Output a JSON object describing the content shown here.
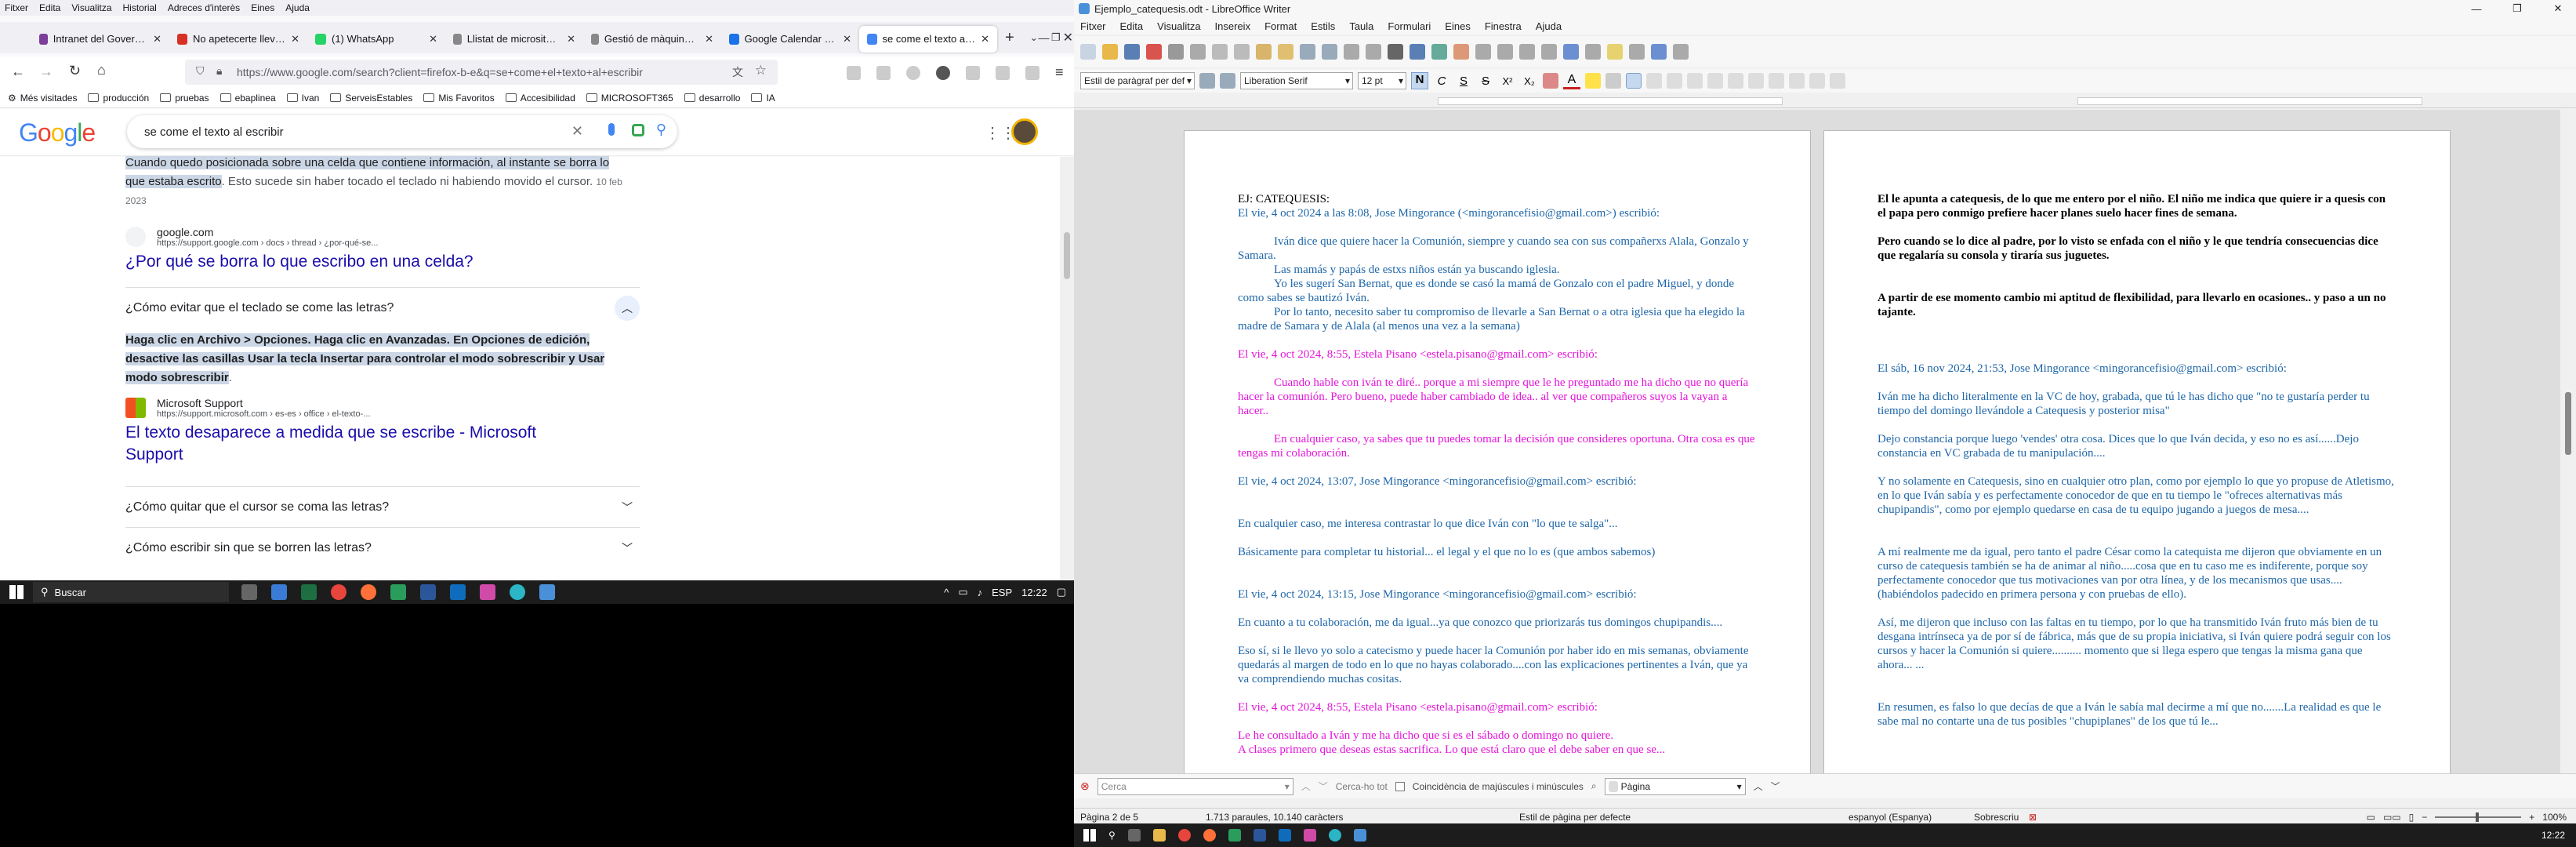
{
  "firefox": {
    "menu": [
      "Fitxer",
      "Edita",
      "Visualitza",
      "Historial",
      "Adreces d'interès",
      "Eines",
      "Ajuda"
    ],
    "tabs": [
      {
        "label": "Intranet del Govern de les I",
        "color": "#7b3f99"
      },
      {
        "label": "No apetecerte llevar a",
        "color": "#d93025"
      },
      {
        "label": "(1) WhatsApp",
        "color": "#25d366"
      },
      {
        "label": "Llistat de microsites - Gesti",
        "color": "#888888"
      },
      {
        "label": "Gestió de màquines - SERVE",
        "color": "#888888"
      },
      {
        "label": "Google Calendar - nov",
        "color": "#1a73e8"
      },
      {
        "label": "se come el texto al esc",
        "color": "#4285f4"
      }
    ],
    "url": "https://www.google.com/search?client=firefox-b-e&q=se+come+el+texto+al+escribir",
    "bookmarks": [
      "Més visitades",
      "producción",
      "pruebas",
      "ebaplinea",
      "Ivan",
      "ServeisEstables",
      "Mis Favoritos",
      "Accesibilidad",
      "MICROSOFT365",
      "desarrollo",
      "IA"
    ],
    "google": {
      "logo": [
        "G",
        "o",
        "o",
        "g",
        "l",
        "e"
      ],
      "query": "se come el texto al escribir",
      "snippet1_hl": "Cuando quedo posicionada sobre una celda que contiene información, al instante se borra lo que estaba escrito",
      "snippet1_rest": ". Esto sucede sin haber tocado el teclado ni habiendo movido el cursor.",
      "snippet1_date": "10 feb 2023",
      "result1_site": "google.com",
      "result1_url": "https://support.google.com › docs › thread › ¿por-qué-se...",
      "result1_title": "¿Por qué se borra lo que escribo en una celda?",
      "faq1": "¿Cómo evitar que el teclado se come las letras?",
      "faq1_answer": "Haga clic en Archivo > Opciones. Haga clic en Avanzadas. En Opciones de edición, desactive las casillas Usar la tecla Insertar para controlar el modo sobrescribir y Usar modo sobrescribir",
      "result2_site": "Microsoft Support",
      "result2_url": "https://support.microsoft.com › es-es › office › el-texto-...",
      "result2_title": "El texto desaparece a medida que se escribe - Microsoft Support",
      "faq2": "¿Cómo quitar que el cursor se coma las letras?",
      "faq3": "¿Cómo escribir sin que se borren las letras?"
    }
  },
  "taskbar1": {
    "search": "Buscar",
    "lang": "ESP",
    "time": "12:22"
  },
  "taskbar2": {
    "time": "12:22"
  },
  "writer": {
    "title": "Ejemplo_catequesis.odt - LibreOffice Writer",
    "menu": [
      "Fitxer",
      "Edita",
      "Visualitza",
      "Insereix",
      "Format",
      "Estils",
      "Taula",
      "Formulari",
      "Eines",
      "Finestra",
      "Ajuda"
    ],
    "para_style": "Estil de paràgraf per def",
    "font": "Liberation Serif",
    "size": "12 pt",
    "find_placeholder": "Cerca",
    "find_next": "Cerca-ho tot",
    "match_case": "Coincidència de majúscules i minúscules",
    "find_scope": "Pàgina",
    "status": {
      "page": "Pàgina 2 de 5",
      "words": "1.713 paraules, 10.140 caràcters",
      "style": "Estil de pàgina per defecte",
      "lang": "espanyol (Espanya)",
      "mode": "Sobrescriu",
      "zoom": "100%"
    },
    "page1": [
      {
        "c": "blk",
        "t": "EJ: CATEQUESIS:"
      },
      {
        "c": "blue",
        "t": "El vie, 4 oct 2024 a las 8:08, Jose Mingorance (<mingorancefisio@gmail.com>) escribió:"
      },
      {
        "c": "gap",
        "t": ""
      },
      {
        "c": "blue ind",
        "t": "Iván dice que quiere hacer la Comunión, siempre y cuando sea con sus compañerxs Alala, Gonzalo y Samara."
      },
      {
        "c": "blue ind",
        "t": "Las mamás y papás de estxs niños están ya buscando iglesia."
      },
      {
        "c": "blue ind",
        "t": "Yo les sugerí San Bernat, que es donde se casó la mamá de Gonzalo con el padre Miguel, y donde como sabes se bautizó Iván."
      },
      {
        "c": "blue ind",
        "t": "Por lo tanto, necesito saber tu compromiso de llevarle a San Bernat o a otra iglesia que ha elegido la madre de Samara y de Alala (al menos una vez a la semana)"
      },
      {
        "c": "gap",
        "t": ""
      },
      {
        "c": "mag",
        "t": "El vie, 4 oct 2024, 8:55, Estela Pisano <estela.pisano@gmail.com> escribió:"
      },
      {
        "c": "gap",
        "t": ""
      },
      {
        "c": "mag ind",
        "t": "Cuando hable con iván te diré.. porque a mi siempre que le he preguntado me ha dicho que no quería hacer la comunión. Pero bueno, puede haber cambiado de idea.. al ver que compañeros suyos la vayan a hacer.."
      },
      {
        "c": "gap",
        "t": ""
      },
      {
        "c": "mag ind",
        "t": "En cualquier caso, ya sabes que tu puedes tomar la decisión que consideres oportuna. Otra cosa es que tengas mi colaboración."
      },
      {
        "c": "gap",
        "t": ""
      },
      {
        "c": "blue",
        "t": "El vie, 4 oct 2024, 13:07, Jose Mingorance <mingorancefisio@gmail.com> escribió:"
      },
      {
        "c": "gap",
        "t": ""
      },
      {
        "c": "gap",
        "t": ""
      },
      {
        "c": "blue",
        "t": "En cualquier caso, me interesa contrastar lo que dice Iván con \"lo que te salga\"..."
      },
      {
        "c": "gap",
        "t": ""
      },
      {
        "c": "blue",
        "t": "Básicamente para completar tu historial... el legal y el que no lo es (que ambos sabemos)"
      },
      {
        "c": "gap",
        "t": ""
      },
      {
        "c": "gap",
        "t": ""
      },
      {
        "c": "blue",
        "t": "El vie, 4 oct 2024, 13:15, Jose Mingorance <mingorancefisio@gmail.com> escribió:"
      },
      {
        "c": "gap",
        "t": ""
      },
      {
        "c": "blue",
        "t": "    En cuanto a tu colaboración, me da igual...ya que conozco que priorizarás tus domingos chupipandis...."
      },
      {
        "c": "gap",
        "t": ""
      },
      {
        "c": "blue",
        "t": "    Eso sí, si le llevo yo solo a catecismo y puede hacer la Comunión por haber ido en mis semanas, obviamente quedarás al margen de todo en lo que no hayas colaborado....con las explicaciones pertinentes a Iván, que ya va comprendiendo muchas cositas."
      },
      {
        "c": "gap",
        "t": ""
      },
      {
        "c": "mag",
        "t": "El vie, 4 oct 2024, 8:55, Estela Pisano <estela.pisano@gmail.com> escribió:"
      },
      {
        "c": "gap",
        "t": ""
      },
      {
        "c": "mag",
        "t": "       Le he consultado a Iván y me ha dicho que si es el sábado o domingo no quiere."
      },
      {
        "c": "mag",
        "t": "A clases primero que deseas estas sacrifica. Lo que está claro que el debe saber en que se..."
      }
    ],
    "page2": [
      {
        "c": "blk bold",
        "t": "El le apunta a catequesis, de lo que me entero por el niño. El niño me indica que quiere ir a quesis con el papa pero conmigo prefiere hacer planes suelo hacer fines de semana."
      },
      {
        "c": "gap",
        "t": ""
      },
      {
        "c": "blk bold",
        "t": "Pero cuando se lo dice al padre, por lo visto se enfada con el niño y le que tendría consecuencias dice que regalaría su consola y tiraría sus juguetes."
      },
      {
        "c": "gap",
        "t": ""
      },
      {
        "c": "gap",
        "t": ""
      },
      {
        "c": "blk bold",
        "t": "A partir de ese momento cambio mi aptitud de flexibilidad, para llevarlo en ocasiones.. y paso a un no tajante."
      },
      {
        "c": "gap",
        "t": ""
      },
      {
        "c": "gap",
        "t": ""
      },
      {
        "c": "gap",
        "t": ""
      },
      {
        "c": "blue",
        "t": "  El sáb, 16 nov 2024, 21:53, Jose Mingorance <mingorancefisio@gmail.com> escribió:"
      },
      {
        "c": "gap",
        "t": ""
      },
      {
        "c": "blue",
        "t": "      Iván me ha dicho literalmente en la VC de hoy, grabada, que tú le has dicho que \"no te gustaría perder tu tiempo del domingo llevándole a Catequesis y posterior misa\""
      },
      {
        "c": "gap",
        "t": ""
      },
      {
        "c": "blue",
        "t": "      Dejo constancia porque luego 'vendes' otra cosa. Dices que lo que Iván decida, y eso no es así......Dejo constancia en VC grabada de tu manipulación...."
      },
      {
        "c": "gap",
        "t": ""
      },
      {
        "c": "blue",
        "t": "      Y no solamente en Catequesis, sino en cualquier otro plan, como por ejemplo lo que yo propuse de Atletismo, en lo que Iván sabía y es perfectamente conocedor de que en tu tiempo le \"ofreces alternativas más chupipandis\", como por ejemplo quedarse en casa de tu equipo jugando a juegos de mesa...."
      },
      {
        "c": "gap",
        "t": ""
      },
      {
        "c": "gap",
        "t": ""
      },
      {
        "c": "blue",
        "t": "      A mí realmente me da igual, pero tanto el padre César como la catequista me dijeron que obviamente en un curso de catequesis también se ha de animar al niño.....cosa que en tu caso me es indiferente, porque soy perfectamente conocedor que tus motivaciones van por otra línea, y de los mecanismos que usas....(habiéndolos padecido en primera persona y con pruebas de ello)."
      },
      {
        "c": "gap",
        "t": ""
      },
      {
        "c": "blue",
        "t": "      Así, me dijeron que incluso con las faltas en tu tiempo, por lo que ha transmitido Iván fruto más bien de tu desgana intrínseca ya de por sí de fábrica, más que de su propia iniciativa, si Iván quiere podrá seguir con los cursos y hacer la Comunión si quiere.......... momento que si llega espero que tengas la misma gana que ahora... ..."
      },
      {
        "c": "gap",
        "t": ""
      },
      {
        "c": "gap",
        "t": ""
      },
      {
        "c": "blue",
        "t": "      En resumen, es falso lo que decías de que a Iván le sabía mal decirme a mí que no.......La realidad es que le sabe mal no contarte una de tus posibles \"chupiplanes\" de los que tú le..."
      }
    ]
  }
}
